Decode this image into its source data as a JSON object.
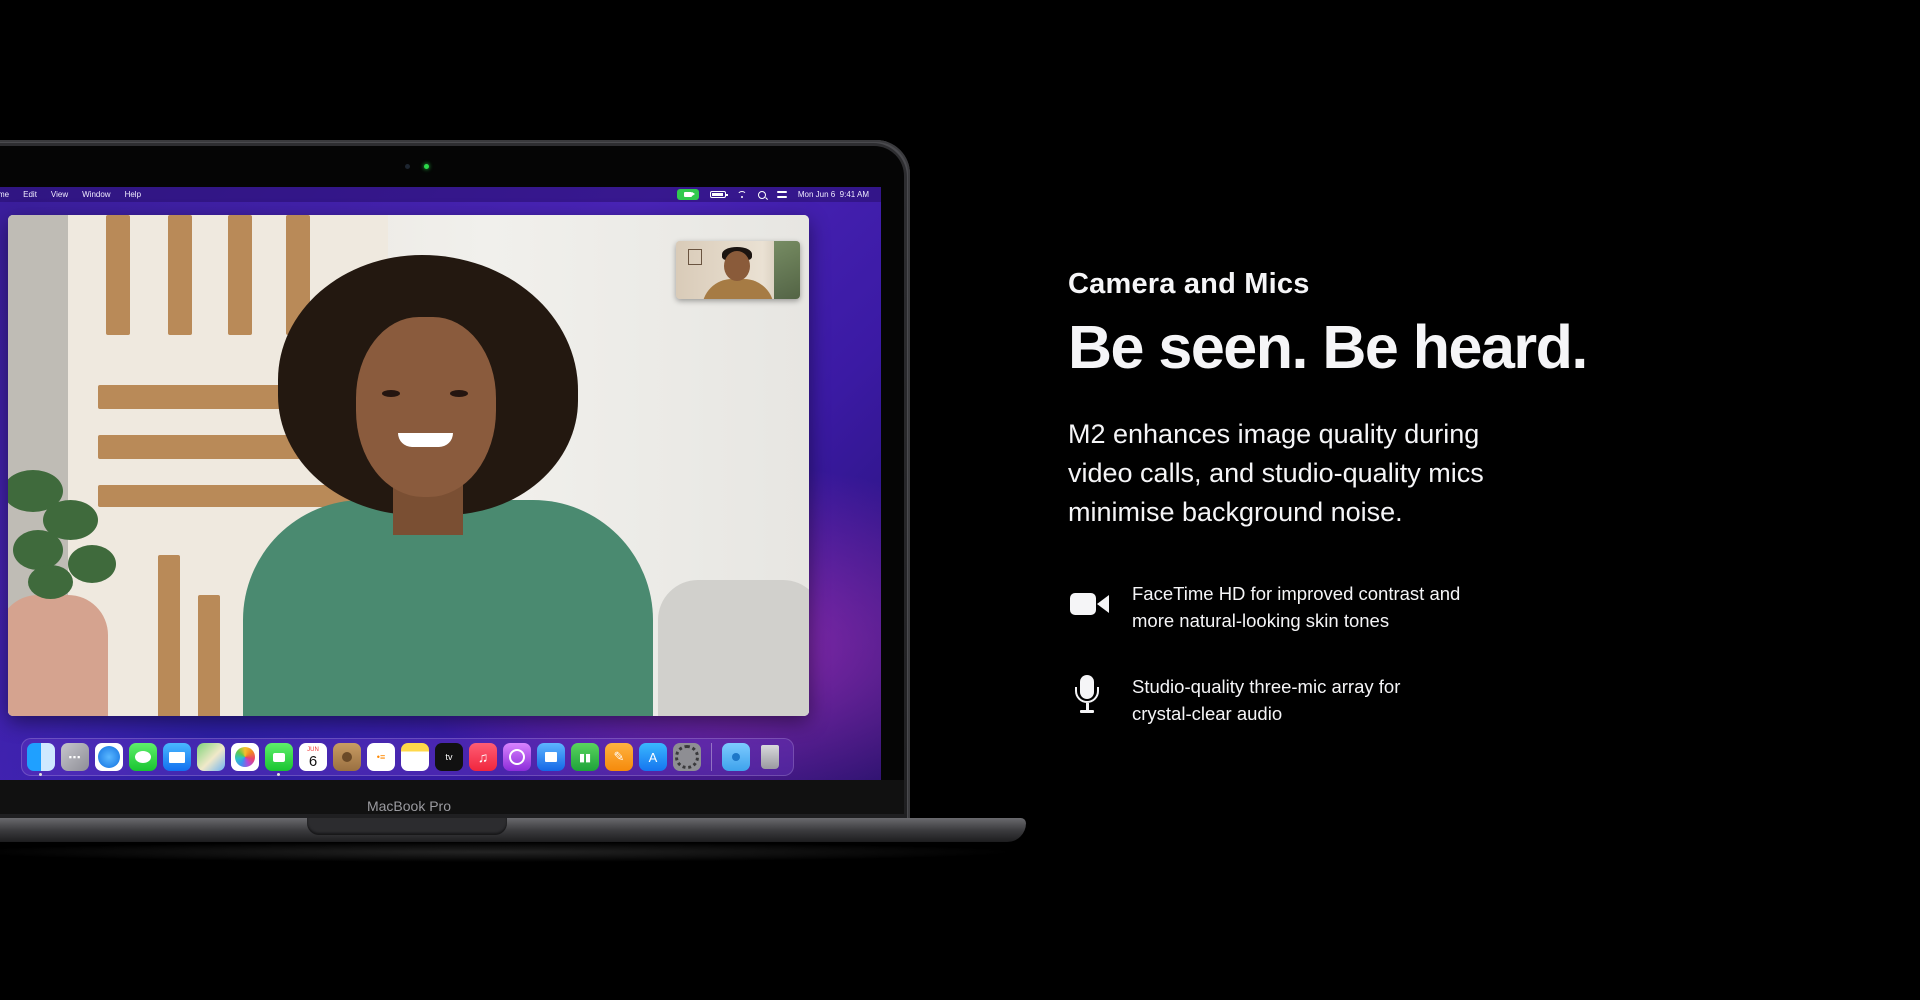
{
  "laptop": {
    "brand_label": "MacBook Pro",
    "menubar": {
      "items": [
        "me",
        "Edit",
        "View",
        "Window",
        "Help"
      ],
      "clock": "Mon Jun 6  9:41 AM"
    },
    "dock": {
      "calendar_day": "6",
      "calendar_month": "JUN",
      "apps": [
        "finder-icon",
        "launchpad-icon",
        "safari-icon",
        "messages-icon",
        "mail-icon",
        "maps-icon",
        "photos-icon",
        "facetime-icon",
        "calendar-icon",
        "contacts-icon",
        "reminders-icon",
        "notes-icon",
        "apple-tv-icon",
        "music-icon",
        "podcasts-icon",
        "keynote-icon",
        "numbers-icon",
        "pages-icon",
        "app-store-icon",
        "system-preferences-icon",
        "downloads-folder-icon",
        "trash-icon"
      ]
    }
  },
  "copy": {
    "eyebrow": "Camera and Mics",
    "headline": "Be seen. Be heard.",
    "body": "M2 enhances image quality during video calls, and studio-quality mics minimise background noise.",
    "features": [
      {
        "icon": "video-camera-icon",
        "text": "FaceTime HD for improved contrast and more natural-looking skin tones"
      },
      {
        "icon": "microphone-icon",
        "text": "Studio-quality three-mic array for crystal-clear audio"
      }
    ]
  },
  "colors": {
    "background": "#000000",
    "text": "#f5f5f7",
    "facetime_green": "#31c94e",
    "wallpaper_purple": "#4a24b8"
  }
}
